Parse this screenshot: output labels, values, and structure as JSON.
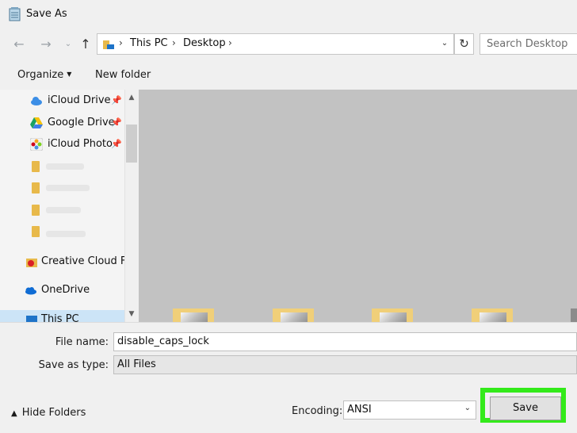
{
  "window": {
    "title": "Save As"
  },
  "address": {
    "breadcrumbs": [
      "This PC",
      "Desktop"
    ]
  },
  "search": {
    "placeholder": "Search Desktop"
  },
  "toolbar": {
    "organize_label": "Organize",
    "new_folder_label": "New folder"
  },
  "nav": {
    "items": [
      {
        "label": "iCloud Drive",
        "icon": "icloud-icon",
        "pinned": true
      },
      {
        "label": "Google Drive",
        "icon": "google-drive-icon",
        "pinned": true
      },
      {
        "label": "iCloud Photo",
        "icon": "icloud-photos-icon",
        "pinned": true
      },
      {
        "label": "Creative Cloud Fil",
        "icon": "creative-cloud-icon",
        "pinned": false
      },
      {
        "label": "OneDrive",
        "icon": "onedrive-icon",
        "pinned": false
      },
      {
        "label": "This PC",
        "icon": "this-pc-icon",
        "pinned": false,
        "selected": true
      }
    ]
  },
  "form": {
    "file_name_label": "File name:",
    "file_name_value": "disable_caps_lock",
    "save_as_type_label": "Save as type:",
    "save_as_type_value": "All Files",
    "encoding_label": "Encoding:",
    "encoding_value": "ANSI"
  },
  "footer": {
    "hide_folders_label": "Hide Folders",
    "save_label": "Save"
  },
  "colors": {
    "highlight": "#33ea1a",
    "content_bg": "#c2c2c2",
    "selected": "#cce4f7"
  }
}
